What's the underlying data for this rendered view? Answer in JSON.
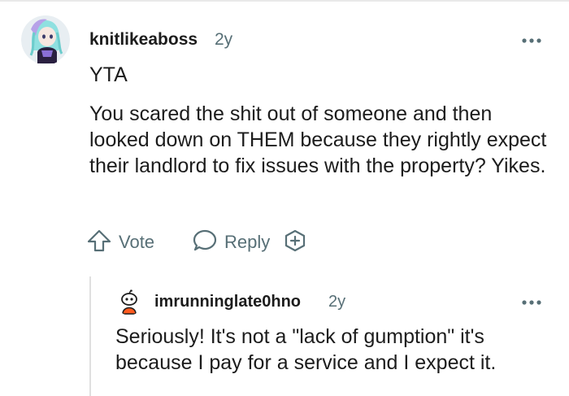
{
  "comment": {
    "username": "knitlikeaboss",
    "age": "2y",
    "verdict": "YTA",
    "body": "You scared the shit out of someone and then looked down on THEM because they rightly expect their landlord to fix issues with the property? Yikes.",
    "avatar_icon": "anime-girl-avatar-icon",
    "more_icon": "more-options-icon",
    "actions": {
      "vote_label": "Vote",
      "reply_label": "Reply",
      "upvote_icon": "upvote-arrow-icon",
      "reply_icon": "speech-bubble-icon",
      "award_icon": "add-award-icon"
    }
  },
  "reply": {
    "username": "imrunninglate0hno",
    "age": "2y",
    "body": "Seriously! It's not a \"lack of gumption\" it's because I pay for a service and I expect it.",
    "avatar_icon": "snoo-avatar-icon",
    "more_icon": "more-options-icon"
  },
  "colors": {
    "text": "#1c1c1c",
    "muted": "#576f76",
    "thread_line": "#e0e0e0"
  }
}
